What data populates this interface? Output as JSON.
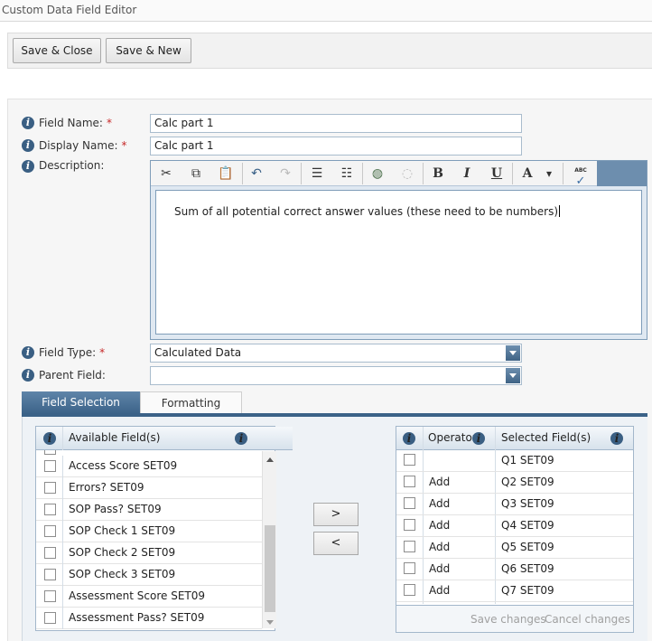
{
  "window": {
    "title": "Custom Data Field Editor"
  },
  "toolbar": {
    "save_close_label": "Save & Close",
    "save_new_label": "Save & New"
  },
  "form": {
    "field_name": {
      "label": "Field Name:",
      "value": "Calc part 1",
      "required": "*"
    },
    "display_name": {
      "label": "Display Name:",
      "value": "Calc part 1",
      "required": "*"
    },
    "description": {
      "label": "Description:",
      "value": "Sum of all potential correct answer values (these need to be numbers)"
    },
    "field_type": {
      "label": "Field Type:",
      "value": "Calculated Data",
      "required": "*"
    },
    "parent_field": {
      "label": "Parent Field:",
      "value": ""
    }
  },
  "editor_toolbar": {
    "bold": "B",
    "italic": "I",
    "underline": "U",
    "font_color": "A",
    "spellcheck": "ABC"
  },
  "icons": {
    "info": "i",
    "cut": "✂",
    "copy": "⧉",
    "paste": "📋",
    "undo": "↶",
    "redo": "↷",
    "ordered_list": "☰",
    "unordered_list": "☷",
    "link": "◍",
    "unlink": "◌",
    "dropdown": "▾",
    "check": "✓"
  },
  "tabs": {
    "field_selection": "Field Selection",
    "formatting": "Formatting"
  },
  "available_fields": {
    "header": "Available Field(s)",
    "items": [
      "Access Score SET09",
      "Errors? SET09",
      "SOP Pass? SET09",
      "SOP Check 1 SET09",
      "SOP Check 2 SET09",
      "SOP Check 3 SET09",
      "Assessment Score SET09",
      "Assessment Pass? SET09"
    ]
  },
  "move_buttons": {
    "add": ">",
    "remove": "<"
  },
  "selected_fields": {
    "operator_header": "Operator",
    "field_header": "Selected Field(s)",
    "rows": [
      {
        "operator": "",
        "field": "Q1 SET09"
      },
      {
        "operator": "Add",
        "field": "Q2 SET09"
      },
      {
        "operator": "Add",
        "field": "Q3 SET09"
      },
      {
        "operator": "Add",
        "field": "Q4 SET09"
      },
      {
        "operator": "Add",
        "field": "Q5 SET09"
      },
      {
        "operator": "Add",
        "field": "Q6 SET09"
      },
      {
        "operator": "Add",
        "field": "Q7 SET09"
      }
    ],
    "save_changes": "Save changes",
    "cancel_changes": "Cancel changes"
  },
  "colors": {
    "accent": "#3b6288",
    "required": "#c62828",
    "info_icon": "#3a5f83"
  }
}
